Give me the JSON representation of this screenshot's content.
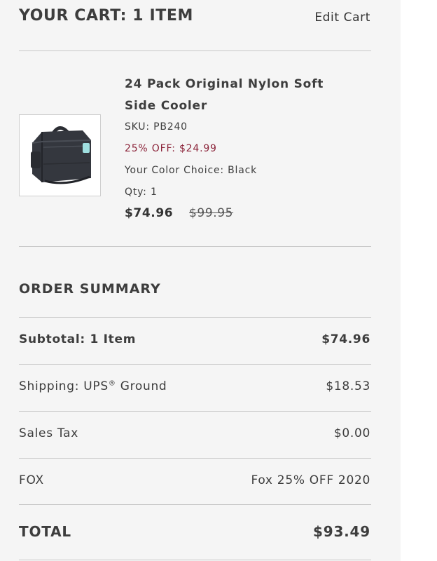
{
  "cart": {
    "title": "YOUR CART: 1 ITEM",
    "edit_label": "Edit Cart"
  },
  "item": {
    "name": "24 Pack Original Nylon Soft Side Cooler",
    "sku": "SKU: PB240",
    "discount": "25% OFF: $24.99",
    "color_choice": "Your Color Choice: Black",
    "qty": "Qty: 1",
    "price": "$74.96",
    "original_price": "$99.95",
    "image_icon": "soft-cooler-bag"
  },
  "summary": {
    "title": "ORDER SUMMARY",
    "subtotal_label": "Subtotal: 1 Item",
    "subtotal_value": "$74.96",
    "shipping_label": "Shipping: UPS",
    "shipping_mark": "®",
    "shipping_suffix": " Ground",
    "shipping_value": "$18.53",
    "tax_label": "Sales Tax",
    "tax_value": "$0.00",
    "promo_label": "FOX",
    "promo_value": "Fox 25% OFF 2020",
    "total_label": "TOTAL",
    "total_value": "$93.49"
  },
  "colors": {
    "panel_bg": "#f5f5f5",
    "text": "#3d3d3d",
    "discount": "#8b2339",
    "divider": "#c9c9c9"
  }
}
